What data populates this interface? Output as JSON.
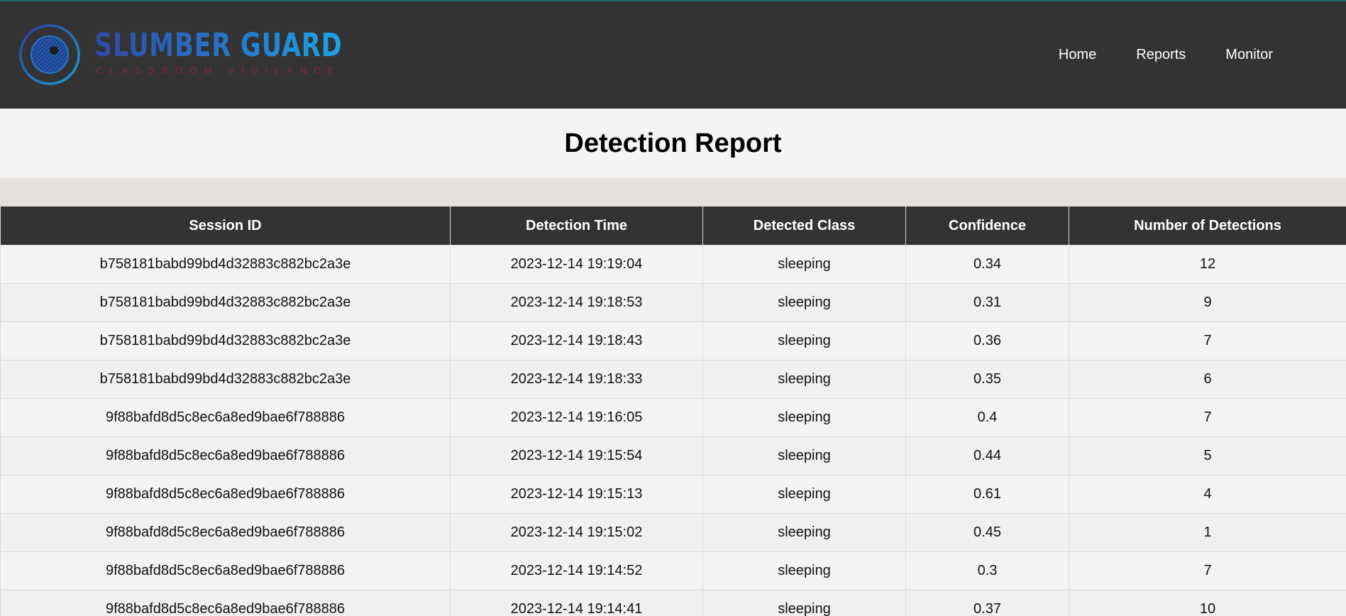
{
  "brand": {
    "name": "SLUMBER GUARD",
    "tagline": "CLASSROOM VIGILANCE",
    "colors": {
      "header_bg": "#333333",
      "accent_line": "#1c6e6a",
      "logo_blue": "#2677c9",
      "tagline": "#7a2b3d"
    }
  },
  "nav": {
    "home": "Home",
    "reports": "Reports",
    "monitor": "Monitor"
  },
  "page": {
    "title": "Detection Report"
  },
  "table": {
    "columns": [
      "Session ID",
      "Detection Time",
      "Detected Class",
      "Confidence",
      "Number of Detections"
    ],
    "rows": [
      [
        "b758181babd99bd4d32883c882bc2a3e",
        "2023-12-14 19:19:04",
        "sleeping",
        "0.34",
        "12"
      ],
      [
        "b758181babd99bd4d32883c882bc2a3e",
        "2023-12-14 19:18:53",
        "sleeping",
        "0.31",
        "9"
      ],
      [
        "b758181babd99bd4d32883c882bc2a3e",
        "2023-12-14 19:18:43",
        "sleeping",
        "0.36",
        "7"
      ],
      [
        "b758181babd99bd4d32883c882bc2a3e",
        "2023-12-14 19:18:33",
        "sleeping",
        "0.35",
        "6"
      ],
      [
        "9f88bafd8d5c8ec6a8ed9bae6f788886",
        "2023-12-14 19:16:05",
        "sleeping",
        "0.4",
        "7"
      ],
      [
        "9f88bafd8d5c8ec6a8ed9bae6f788886",
        "2023-12-14 19:15:54",
        "sleeping",
        "0.44",
        "5"
      ],
      [
        "9f88bafd8d5c8ec6a8ed9bae6f788886",
        "2023-12-14 19:15:13",
        "sleeping",
        "0.61",
        "4"
      ],
      [
        "9f88bafd8d5c8ec6a8ed9bae6f788886",
        "2023-12-14 19:15:02",
        "sleeping",
        "0.45",
        "1"
      ],
      [
        "9f88bafd8d5c8ec6a8ed9bae6f788886",
        "2023-12-14 19:14:52",
        "sleeping",
        "0.3",
        "7"
      ],
      [
        "9f88bafd8d5c8ec6a8ed9bae6f788886",
        "2023-12-14 19:14:41",
        "sleeping",
        "0.37",
        "10"
      ]
    ]
  }
}
